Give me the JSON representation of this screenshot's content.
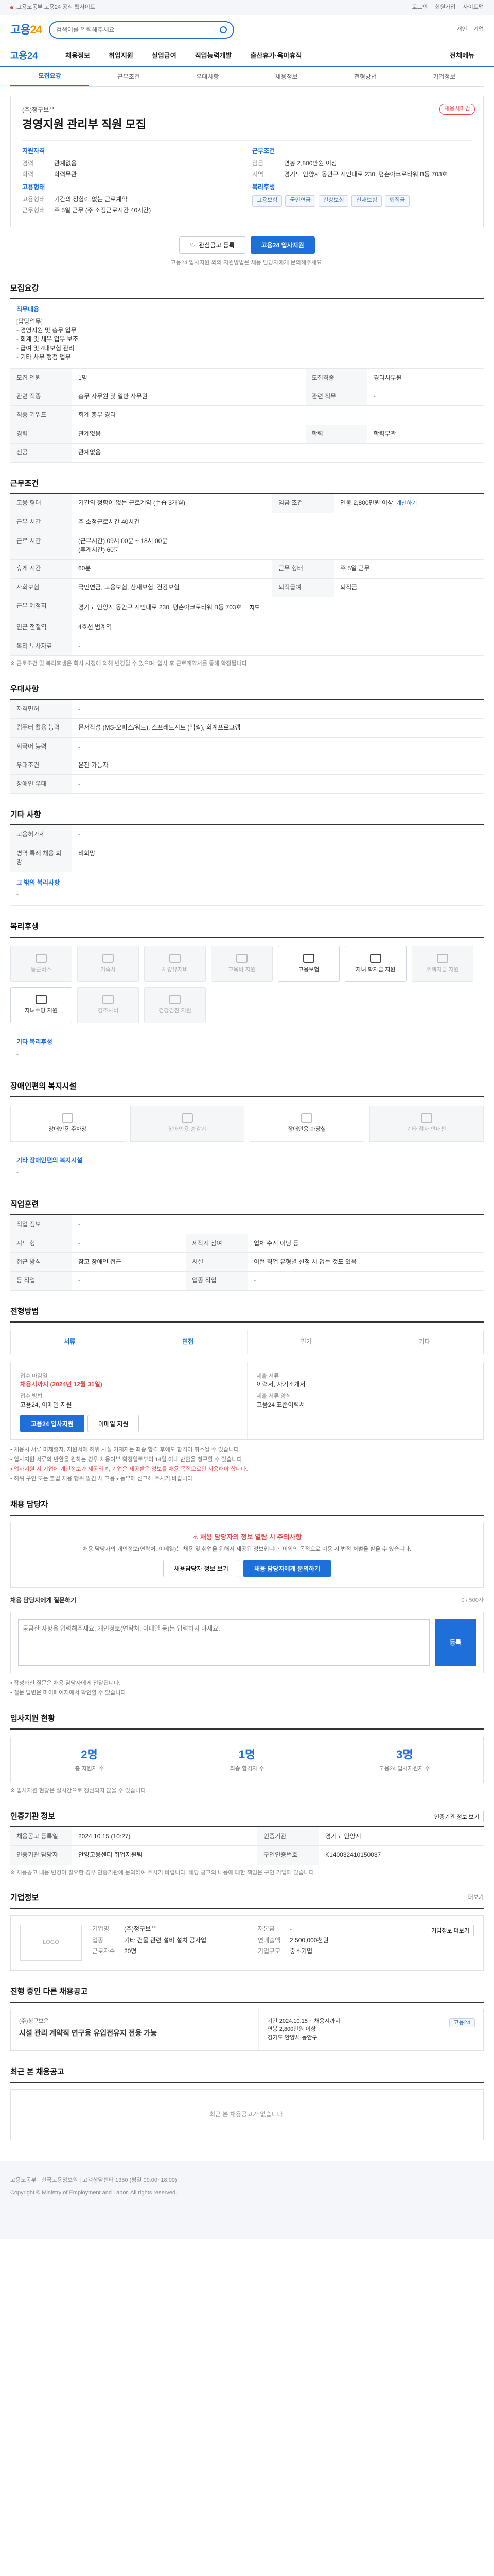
{
  "topbar": {
    "notice": "고용노동부 고용24 공식 웹사이트",
    "login": "로그인",
    "join": "회원가입",
    "sitemap": "사이트맵"
  },
  "brand": {
    "logo_a": "고용",
    "logo_b": "24",
    "search_placeholder": "검색어를 입력해주세요",
    "menu1": "개인",
    "menu2": "기업"
  },
  "gnb": {
    "logo": "고용24",
    "items": [
      "채용정보",
      "취업지원",
      "실업급여",
      "직업능력개발",
      "출산휴가·육아휴직"
    ],
    "more": "전체메뉴"
  },
  "ltabs": [
    "모집요강",
    "근무조건",
    "우대사항",
    "채용정보",
    "전형방법",
    "기업정보"
  ],
  "job": {
    "close_badge": "채용시마감",
    "company": "(주)청구보은",
    "title": "경영지원 관리부 직원 모집",
    "h_qual": "지원자격",
    "career_k": "경력",
    "career_v": "관계없음",
    "edu_k": "학력",
    "edu_v": "학력무관",
    "h_cond": "근무조건",
    "pay_k": "임금",
    "pay_v": "연봉 2,800만원 이상",
    "loc_k": "지역",
    "loc_v": "경기도 안양시 동안구 시민대로 230, 평촌아크로타워 B동 703호",
    "h_type": "고용형태",
    "type_k": "고용형태",
    "type_v": "기간의 정함이 없는 근로계약",
    "hours_k": "근무형태",
    "hours_v": "주 5일 근무 (주 소정근로시간 40시간)",
    "h_welfare": "복리후생",
    "chips": [
      "고용보험",
      "국민연금",
      "건강보험",
      "산재보험",
      "퇴직금"
    ],
    "scrap": "관심공고 등록",
    "apply": "고용24 입사지원",
    "note": "고용24 입사지원 외의 지원방법은 채용 담당자에게 문의해주세요."
  },
  "req": {
    "h": "모집요강",
    "desc_title": "직무내용",
    "desc": "[담당업무]\n- 경영지원 및 총무 업무\n- 회계 및 세무 업무 보조\n- 급여 및 4대보험 관리\n- 기타 사무 행정 업무",
    "rows": [
      {
        "k": "모집 인원",
        "v": "1명",
        "k2": "모집직종",
        "v2": "경리사무원"
      },
      {
        "k": "관련 직종",
        "v": "총무 사무원 및 일반 사무원",
        "k2": "관련 직무",
        "v2": "-"
      },
      {
        "k": "직종 키워드",
        "v": "회계 총무 경리",
        "k2": "",
        "v2": ""
      },
      {
        "k": "경력",
        "v": "관계없음",
        "k2": "학력",
        "v2": "학력무관"
      },
      {
        "k": "전공",
        "v": "관계없음",
        "k2": "",
        "v2": ""
      }
    ]
  },
  "work": {
    "h": "근무조건",
    "rows": [
      {
        "k": "고용 형태",
        "v": "기간의 정함이 없는 근로계약 (수습 3개월)",
        "k2": "임금 조건",
        "v2": "연봉 2,800만원 이상",
        "link2": "계산하기"
      },
      {
        "k": "근무 시간",
        "v": "주 소정근로시간 40시간",
        "k2": "",
        "v2": ""
      },
      {
        "k": "근로 시간",
        "v": "(근무시간) 09시 00분 ~ 18시 00분\n(휴게시간) 60분",
        "k2": "",
        "v2": ""
      },
      {
        "k": "휴게 시간",
        "v": "60분",
        "k2": "근무 형태",
        "v2": "주 5일 근무"
      },
      {
        "k": "사회보험",
        "v": "국민연금, 고용보험, 산재보험, 건강보험",
        "k2": "퇴직급여",
        "v2": "퇴직금"
      },
      {
        "k": "근무 예정지",
        "v": "경기도 안양시 동안구 시민대로 230, 평촌아크로타워 B동 703호",
        "k2": "",
        "v2": ""
      },
      {
        "k": "인근 전철역",
        "v": "4호선 범계역",
        "k2": "",
        "v2": ""
      },
      {
        "k": "복리 노사자료",
        "v": "-",
        "k2": "",
        "v2": ""
      }
    ],
    "map_btn": "지도",
    "note": "※ 근로조건 및 복리후생은 회사 사정에 의해 변경될 수 있으며, 입사 후 근로계약서를 통해 확정됩니다."
  },
  "pref": {
    "h": "우대사항",
    "rows": [
      {
        "k": "자격면허",
        "v": "-"
      },
      {
        "k": "컴퓨터 활용 능력",
        "v": "문서작성 (MS-오피스/워드), 스프레드시트 (엑셀), 회계프로그램"
      },
      {
        "k": "외국어 능력",
        "v": "-"
      },
      {
        "k": "우대조건",
        "v": "운전 가능자"
      },
      {
        "k": "장애인 우대",
        "v": "-"
      }
    ]
  },
  "extra": {
    "h": "기타 사항",
    "rows": [
      {
        "k": "고용허가제",
        "v": "-"
      },
      {
        "k": "병역 특례 채용 희망",
        "v": "비희망"
      }
    ],
    "sub": "그 밖의 복리사항",
    "subv": "-"
  },
  "welfare": {
    "h": "복리후생",
    "tiles": [
      {
        "l": "통근버스",
        "on": false
      },
      {
        "l": "기숙사",
        "on": false
      },
      {
        "l": "차량유지비",
        "on": false
      },
      {
        "l": "교육비 지원",
        "on": false
      },
      {
        "l": "고용보험",
        "on": true
      },
      {
        "l": "자녀 학자금 지원",
        "on": true
      },
      {
        "l": "주택자금 지원",
        "on": false
      },
      {
        "l": "자녀수당 지원",
        "on": true
      },
      {
        "l": "경조사비",
        "on": false
      },
      {
        "l": "건강검진 지원",
        "on": false
      }
    ],
    "other_h": "기타 복리후생",
    "other_v": "-"
  },
  "disab": {
    "h": "장애인편의 복지시설",
    "tiles": [
      {
        "l": "장애인용 주차장",
        "on": true
      },
      {
        "l": "장애인용 승강기",
        "on": false
      },
      {
        "l": "장애인용 화장실",
        "on": true
      },
      {
        "l": "기타 점자 안내판",
        "on": false
      }
    ],
    "other_h": "기타 장애인편의 복지시설",
    "other_v": "-"
  },
  "train": {
    "h": "직업훈련",
    "rows": [
      {
        "k": "직업 정보",
        "v": "-",
        "k2": "",
        "v2": ""
      },
      {
        "k": "지도 형",
        "v": "-",
        "k2": "제작시 참여",
        "v2": "업체 수시 이닝 등"
      },
      {
        "k": "접근 방식",
        "v": "참고 장애인 접근",
        "k2": "시설",
        "v2": "이런 직업 유형별 신청 시 없는 것도 있음"
      },
      {
        "k": "등 직업",
        "v": "-",
        "k2": "업종 직업",
        "v2": "-"
      }
    ]
  },
  "process": {
    "h": "전형방법",
    "tabs": [
      {
        "l": "서류",
        "on": true
      },
      {
        "l": "면접",
        "on": true
      },
      {
        "l": "필기",
        "on": false
      },
      {
        "l": "기타",
        "on": false
      }
    ],
    "deadline_k": "접수 마감일",
    "deadline_v": "채용시까지 (2024년 12월 31일)",
    "method_k": "접수 방법",
    "method_v": "고용24, 이메일 지원",
    "apply_btn": "고용24 입사지원",
    "email_btn": "이메일 지원",
    "doc_k": "제출 서류",
    "doc_v": "이력서, 자기소개서",
    "docform_k": "제출 서류 양식",
    "docform_v": "고용24 표준이력서",
    "bullets": [
      "• 채용시 서류 미제출자, 지원서에 허위 사실 기재자는 최종 합격 후에도 합격이 취소될 수 있습니다.",
      "• 입사지원 서류의 반환을 원하는 경우 채용여부 확정일로부터 14일 이내 반환을 청구할 수 있습니다.",
      "• 허위 구인 또는 불법 채용 행위 발견 시 고용노동부에 신고해 주시기 바랍니다."
    ],
    "bullets_red": "• 입사지원 시 기업에 개인정보가 제공되며, 기업은 제공받은 정보를 채용 목적으로만 사용해야 합니다."
  },
  "contact": {
    "h": "채용 담당자",
    "warn": "채용 담당자의 정보 열람 시 주의사항",
    "p": "채용 담당자의 개인정보(연락처, 이메일)는 채용 및 취업을 위해서 제공된 정보입니다. 이외의 목적으로 이용 시 법적 처벌을 받을 수 있습니다.",
    "btn1": "채용담당자 정보 보기",
    "btn2": "채용 담당자에게 문의하기",
    "qa_h": "채용 담당자에게 질문하기",
    "qa_count": "0 / 500자",
    "qa_placeholder": "궁금한 사항을 입력해주세요. 개인정보(연락처, 이메일 등)는 입력하지 마세요.",
    "send": "등록",
    "fine1": "• 작성하신 질문은 채용 담당자에게 전달됩니다.",
    "fine2": "• 질문 답변은 마이페이지에서 확인할 수 있습니다."
  },
  "stats": {
    "h": "입사지원 현황",
    "refresh": "현황",
    "items": [
      {
        "n": "2명",
        "l": "총 지원자 수"
      },
      {
        "n": "1명",
        "l": "최종 합격자 수"
      },
      {
        "n": "3명",
        "l": "고용24 입사지원자 수"
      }
    ],
    "note": "※ 입사지원 현황은 실시간으로 갱신되지 않을 수 있습니다."
  },
  "cert": {
    "h": "인증기관 정보",
    "btn": "인증기관 정보 보기",
    "rows": [
      {
        "k": "채용공고 등록일",
        "v": "2024.10.15 (10:27)",
        "k2": "인증기관",
        "v2": "경기도 안양시"
      },
      {
        "k": "인증기관 담당자",
        "v": "안양고용센터 취업지원팀",
        "k2": "구인인증번호",
        "v2": "K140032410150037"
      }
    ],
    "note": "※ 채용공고 내용 변경이 필요한 경우 인증기관에 문의하여 주시기 바랍니다. 해당 공고의 내용에 대한 책임은 구인 기업에 있습니다."
  },
  "corp": {
    "h": "기업정보",
    "more": "더보기",
    "logo": "LOGO",
    "name_k": "기업명",
    "name_v": "(주)청구보은",
    "ind_k": "업종",
    "ind_v": "기타 건물 관련 설비 설치 공사업",
    "emp_k": "근로자수",
    "emp_v": "20명",
    "cap_k": "자본금",
    "cap_v": "-",
    "sales_k": "연매출액",
    "sales_v": "2,500,000천원",
    "size_k": "기업규모",
    "size_v": "중소기업",
    "btn": "기업정보 더보기"
  },
  "related": {
    "h": "진행 중인 다른 채용공고",
    "company": "(주)청구보은",
    "title": "시설 관리 계약직 연구용 유입전유지 전용 가능",
    "d1": "기간 2024.10.15 ~ 채용시까지",
    "d2": "연봉 2,800만원 이상",
    "d3": "경기도 안양시 동안구",
    "badge": "고용24"
  },
  "recent": {
    "h": "최근 본 채용공고",
    "empty": "최근 본 채용공고가 없습니다."
  },
  "footer": {
    "text": "고용노동부 · 한국고용정보원 | 고객상담센터 1350 (평일 09:00~18:00)",
    "copy": "Copyright © Ministry of Employment and Labor. All rights reserved."
  }
}
